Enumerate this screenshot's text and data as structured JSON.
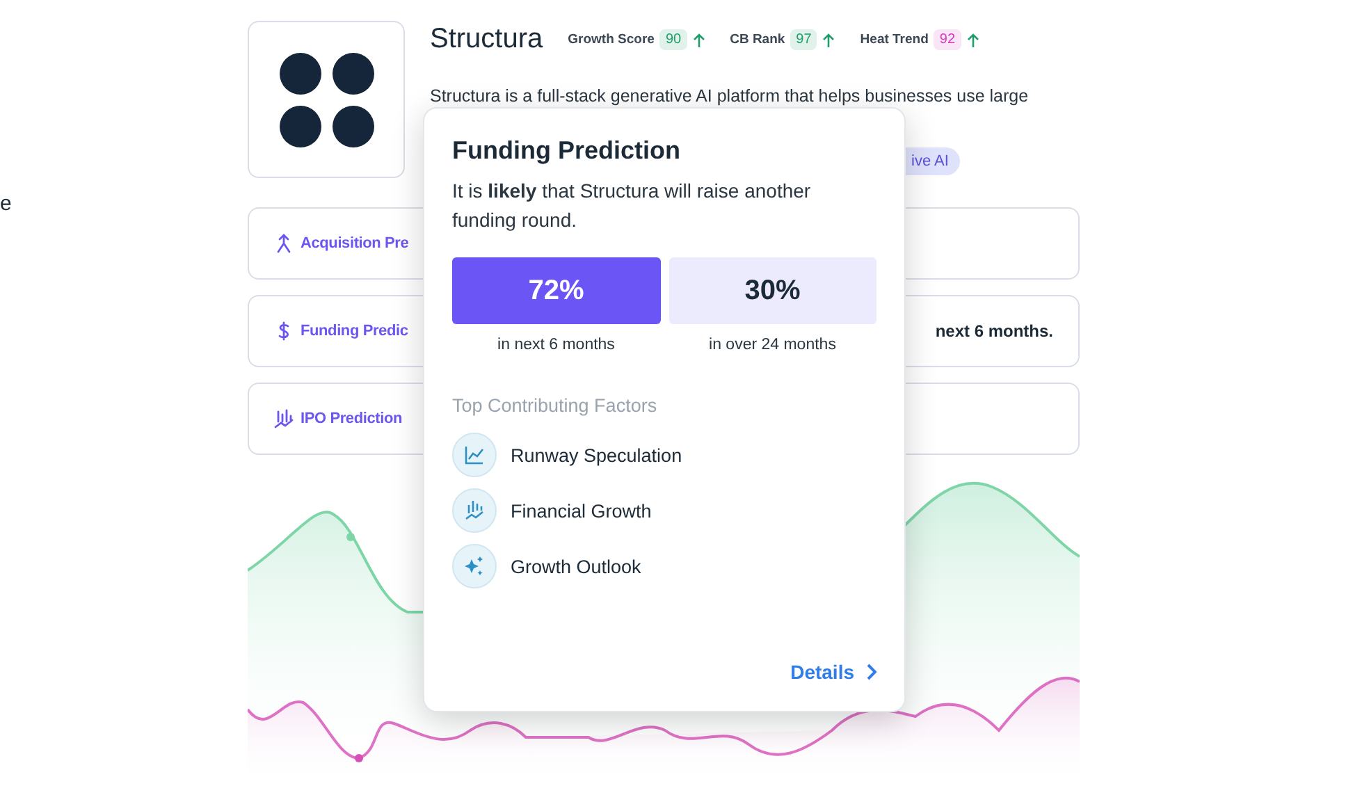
{
  "edge_text": "e",
  "company": {
    "name": "Structura",
    "description": "Structura is a full-stack generative AI platform that helps businesses use large",
    "scores": [
      {
        "label": "Growth Score",
        "value": "90",
        "color": "#1f9d6b"
      },
      {
        "label": "CB Rank",
        "value": "97",
        "color": "#1f9d6b"
      },
      {
        "label": "Heat Trend",
        "value": "92",
        "color": "#d63bbf"
      }
    ],
    "tag": "ive AI"
  },
  "predictions": [
    {
      "kind": "acquisition",
      "label": "Acquisition Pre"
    },
    {
      "kind": "funding",
      "label": "Funding Predic",
      "detail": "next 6 months."
    },
    {
      "kind": "ipo",
      "label": "IPO Prediction"
    }
  ],
  "popover": {
    "title": "Funding Prediction",
    "text": "It is **likely** that Structura will raise another funding round.",
    "outcomes": [
      {
        "value": "72%",
        "caption": "in next 6 months",
        "highlighted": true
      },
      {
        "value": "30%",
        "caption": "in over 24 months",
        "highlighted": false
      }
    ],
    "factors_heading": "Top Contributing Factors",
    "factors": [
      {
        "kind": "chart",
        "label": "Runway Speculation"
      },
      {
        "kind": "bars",
        "label": "Financial Growth"
      },
      {
        "kind": "sparkle",
        "label": "Growth Outlook"
      }
    ],
    "link": "Details"
  }
}
